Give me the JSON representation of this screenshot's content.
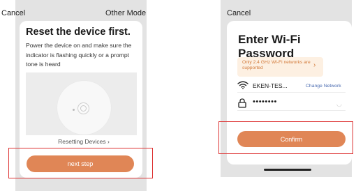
{
  "left_screen": {
    "cancel_label": "Cancel",
    "other_mode_label": "Other Mode",
    "title": "Reset the device first.",
    "description": "Power the device on and make sure the indicator is flashing quickly or a prompt tone is heard",
    "resetting_link": "Resetting Devices ›",
    "next_button": "next step"
  },
  "right_screen": {
    "cancel_label": "Cancel",
    "title": "Enter Wi-Fi Password",
    "warning_text": "Only 2.4 GHz Wi-Fi networks are supported",
    "warning_chevron": "›",
    "network_name": "EKEN-TES...",
    "change_network_label": "Change Network",
    "password_masked": "••••••••",
    "confirm_button": "Confirm"
  },
  "colors": {
    "accent": "#e08656",
    "highlight": "#dd3333",
    "warning_bg": "#fdf0e2",
    "warning_text": "#d27a3a",
    "link": "#4a6bb0"
  },
  "icons": {
    "wifi": "wifi-icon",
    "lock": "lock-icon",
    "eye": "eye-hidden-icon",
    "device_button": "power-button-icon"
  }
}
